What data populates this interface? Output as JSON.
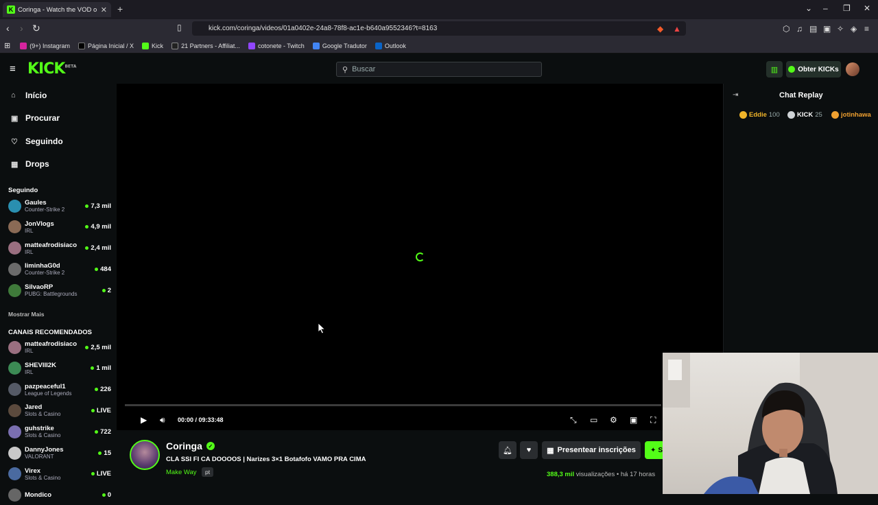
{
  "browser": {
    "tab_title": "Coringa - Watch the VOD on",
    "url": "kick.com/coringa/videos/01a0402e-24a8-78f8-ac1e-b640a9552346?t=8163",
    "bookmarks": [
      "(9+) Instagram",
      "Página Inicial / X",
      "Kick",
      "21 Partners - Affiliat...",
      "cotonete - Twitch",
      "Google Tradutor",
      "Outlook"
    ]
  },
  "header": {
    "logo": "KICK",
    "logo_badge": "BETA",
    "search_placeholder": "Buscar",
    "kicks_label": "Obter KICKs"
  },
  "sidebar": {
    "nav": [
      "Início",
      "Procurar",
      "Seguindo",
      "Drops"
    ],
    "following_title": "Seguindo",
    "following": [
      {
        "name": "Gaules",
        "category": "Counter-Strike 2",
        "viewers": "7,3 mil",
        "color": "#2a8fb0"
      },
      {
        "name": "JonVlogs",
        "category": "IRL",
        "viewers": "4,9 mil",
        "color": "#8a6a55"
      },
      {
        "name": "matteafrodisiaco",
        "category": "IRL",
        "viewers": "2,4 mil",
        "color": "#9a6f80"
      },
      {
        "name": "liminhaG0d",
        "category": "Counter-Strike 2",
        "viewers": "484",
        "color": "#6b6b6b"
      },
      {
        "name": "SilvaoRP",
        "category": "PUBG: Battlegrounds",
        "viewers": "2",
        "color": "#3f7a3a"
      }
    ],
    "show_more": "Mostrar Mais",
    "recommended_title": "CANAIS RECOMENDADOS",
    "recommended": [
      {
        "name": "matteafrodisiaco",
        "category": "IRL",
        "viewers": "2,5 mil",
        "color": "#9a6f80"
      },
      {
        "name": "SHEVIII2K",
        "category": "IRL",
        "viewers": "1 mil",
        "color": "#3c8a54"
      },
      {
        "name": "pazpeaceful1",
        "category": "League of Legends",
        "viewers": "226",
        "color": "#555a66"
      },
      {
        "name": "Jared",
        "category": "Slots & Casino",
        "viewers": "LIVE",
        "color": "#5b4a3d"
      },
      {
        "name": "guhstrike",
        "category": "Slots & Casino",
        "viewers": "722",
        "color": "#7a6fb0"
      },
      {
        "name": "DannyJones",
        "category": "VALORANT",
        "viewers": "15",
        "color": "#c9c9c9"
      },
      {
        "name": "Virex",
        "category": "Slots & Casino",
        "viewers": "LIVE",
        "color": "#4a6aa0"
      },
      {
        "name": "Mondico",
        "category": "",
        "viewers": "0",
        "color": "#666"
      }
    ]
  },
  "player": {
    "time": "00:00 / 09:33:48",
    "progress": 0
  },
  "stream": {
    "streamer": "Coringa",
    "title": "CLA SSI FI CA DOOOOS | Narizes 3×1 Botafofo VAMO PRA CIMA",
    "category": "Make Way",
    "language": "pt",
    "gift_label": "Presentear inscrições",
    "follow_label": "Se",
    "views_count": "388,3 mil",
    "views_label": "visualizações",
    "ago": "há 17 horas"
  },
  "chat": {
    "title": "Chat Replay",
    "gifters": [
      {
        "name": "Eddie",
        "amount": "100",
        "color": "#f0b429"
      },
      {
        "name": "KICK",
        "amount": "25",
        "color": "#cfd3d6"
      },
      {
        "name": "jotinhawa",
        "amount": "",
        "color": "#f0a030"
      }
    ]
  },
  "colors": {
    "accent": "#53fc18",
    "background": "#0b0e0f"
  }
}
